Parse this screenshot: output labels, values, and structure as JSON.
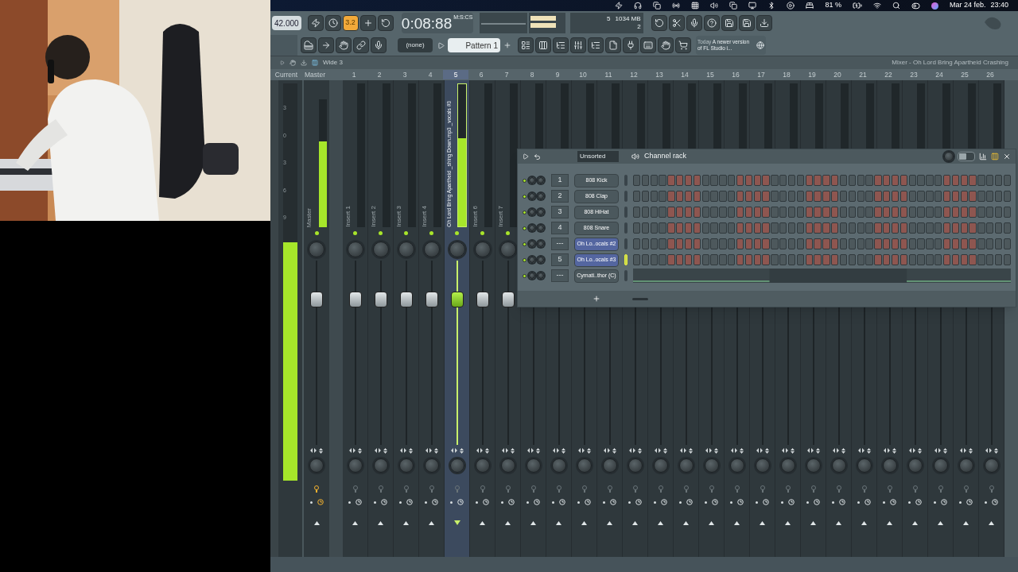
{
  "menubar": {
    "battery": "81 %",
    "date": "Mar 24 feb.",
    "time": "23:40"
  },
  "toolbar": {
    "tempo": "42.000",
    "snap": {
      "label": "3.2",
      "on": true
    },
    "time": "0:08:88",
    "time_format": "M:S:CS",
    "cpu": "5",
    "memory": "1034 MB",
    "polyphony": "2",
    "pattern_select": "(none)",
    "pattern": "Pattern 1",
    "news_label": "Today",
    "news": "A newer version of FL Studio i..."
  },
  "mixer": {
    "preset": "Wide 3",
    "title": "Mixer - Oh Lord Bring Apartheid Crashing",
    "current": {
      "label": "Current",
      "scale": [
        "3",
        "0",
        "3",
        "6",
        "9"
      ],
      "level": 0.6
    },
    "master": {
      "label": "Master",
      "name": "Master",
      "level": 0.67
    },
    "inserts": [
      {
        "number": "1",
        "name": "Insert 1",
        "selected": false
      },
      {
        "number": "2",
        "name": "Insert 2",
        "selected": false
      },
      {
        "number": "3",
        "name": "Insert 3",
        "selected": false
      },
      {
        "number": "4",
        "name": "Insert 4",
        "selected": false
      },
      {
        "number": "5",
        "name": "Oh Lord Bring Apartheid _shing Down.mp3 _vocals #3",
        "level": 0.62,
        "selected": true
      },
      {
        "number": "6",
        "name": "Insert 6",
        "selected": false
      },
      {
        "number": "7",
        "name": "Insert 7",
        "selected": false
      },
      {
        "number": "8",
        "selected": false
      },
      {
        "number": "9",
        "selected": false
      },
      {
        "number": "10",
        "selected": false
      },
      {
        "number": "11",
        "selected": false
      },
      {
        "number": "12",
        "selected": false
      },
      {
        "number": "13",
        "selected": false
      },
      {
        "number": "14",
        "selected": false
      },
      {
        "number": "15",
        "selected": false
      },
      {
        "number": "16",
        "selected": false
      },
      {
        "number": "17",
        "selected": false
      },
      {
        "number": "18",
        "selected": false
      },
      {
        "number": "19",
        "selected": false
      },
      {
        "number": "20",
        "selected": false
      },
      {
        "number": "21",
        "selected": false
      },
      {
        "number": "22",
        "selected": false
      },
      {
        "number": "23",
        "selected": false
      },
      {
        "number": "24",
        "selected": false
      },
      {
        "number": "25",
        "selected": false
      },
      {
        "number": "26",
        "selected": false
      }
    ]
  },
  "channel_rack": {
    "title": "Channel rack",
    "filter": "Unsorted",
    "swing": {
      "level": 0.5
    },
    "channels": [
      {
        "kind": "steps",
        "number": "1",
        "name": "808 Kick",
        "selected": false,
        "focused": false
      },
      {
        "kind": "steps",
        "number": "2",
        "name": "808 Clap",
        "selected": false,
        "focused": false
      },
      {
        "kind": "steps",
        "number": "3",
        "name": "808 HiHat",
        "selected": false,
        "focused": false
      },
      {
        "kind": "steps",
        "number": "4",
        "name": "808 Snare",
        "selected": false,
        "focused": false
      },
      {
        "kind": "steps",
        "number": "---",
        "name": "Oh Lo..ocals #2",
        "selected": true,
        "focused": false
      },
      {
        "kind": "steps",
        "number": "5",
        "name": "Oh Lo..ocals #3",
        "selected": true,
        "focused": true
      },
      {
        "kind": "graph",
        "number": "---",
        "name": "Cymati..thor (C)",
        "selected": false,
        "focused": false
      }
    ]
  }
}
